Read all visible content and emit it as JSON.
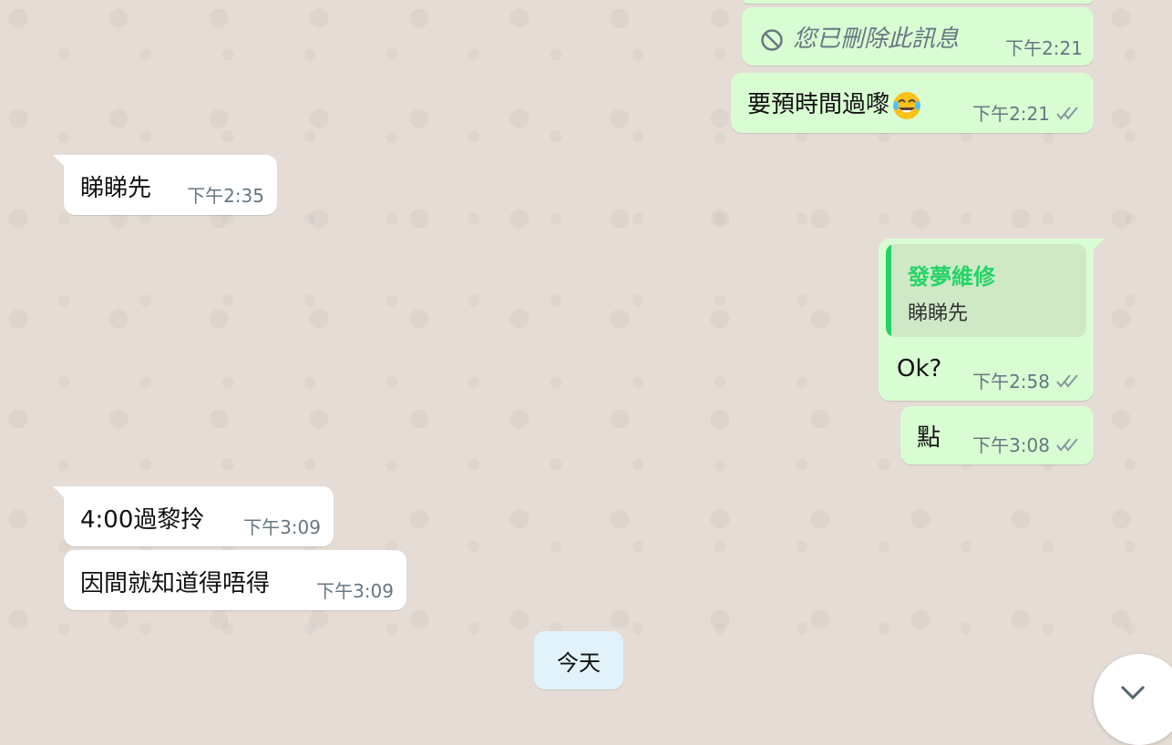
{
  "icons": {
    "deleted": "ban-icon",
    "read_receipt": "double-check-icon",
    "emoji": "tears-of-joy-emoji",
    "scroll": "chevron-down-icon"
  },
  "colors": {
    "chat_bg": "#e5ddd5",
    "incoming_bubble": "#ffffff",
    "outgoing_bubble": "#d9fdd3",
    "quote_accent": "#25d366",
    "timestamp": "#667781"
  },
  "messages": [
    {
      "id": "m1",
      "direction": "out",
      "deleted": true,
      "text": "您已刪除此訊息",
      "time": "下午2:21"
    },
    {
      "id": "m2",
      "direction": "out",
      "text": "要預時間過嚟",
      "emoji": "😂",
      "time": "下午2:21",
      "read": true
    },
    {
      "id": "m3",
      "direction": "in",
      "text": "睇睇先",
      "time": "下午2:35"
    },
    {
      "id": "m4",
      "direction": "out",
      "quote": {
        "sender": "發夢維修",
        "text": "睇睇先"
      },
      "text": "Ok?",
      "time": "下午2:58",
      "read": true
    },
    {
      "id": "m5",
      "direction": "out",
      "text": "點",
      "time": "下午3:08",
      "read": true
    },
    {
      "id": "m6",
      "direction": "in",
      "text": "4:00過黎拎",
      "time": "下午3:09"
    },
    {
      "id": "m7",
      "direction": "in",
      "text": "因間就知道得唔得",
      "time": "下午3:09"
    }
  ],
  "date_separator": "今天"
}
